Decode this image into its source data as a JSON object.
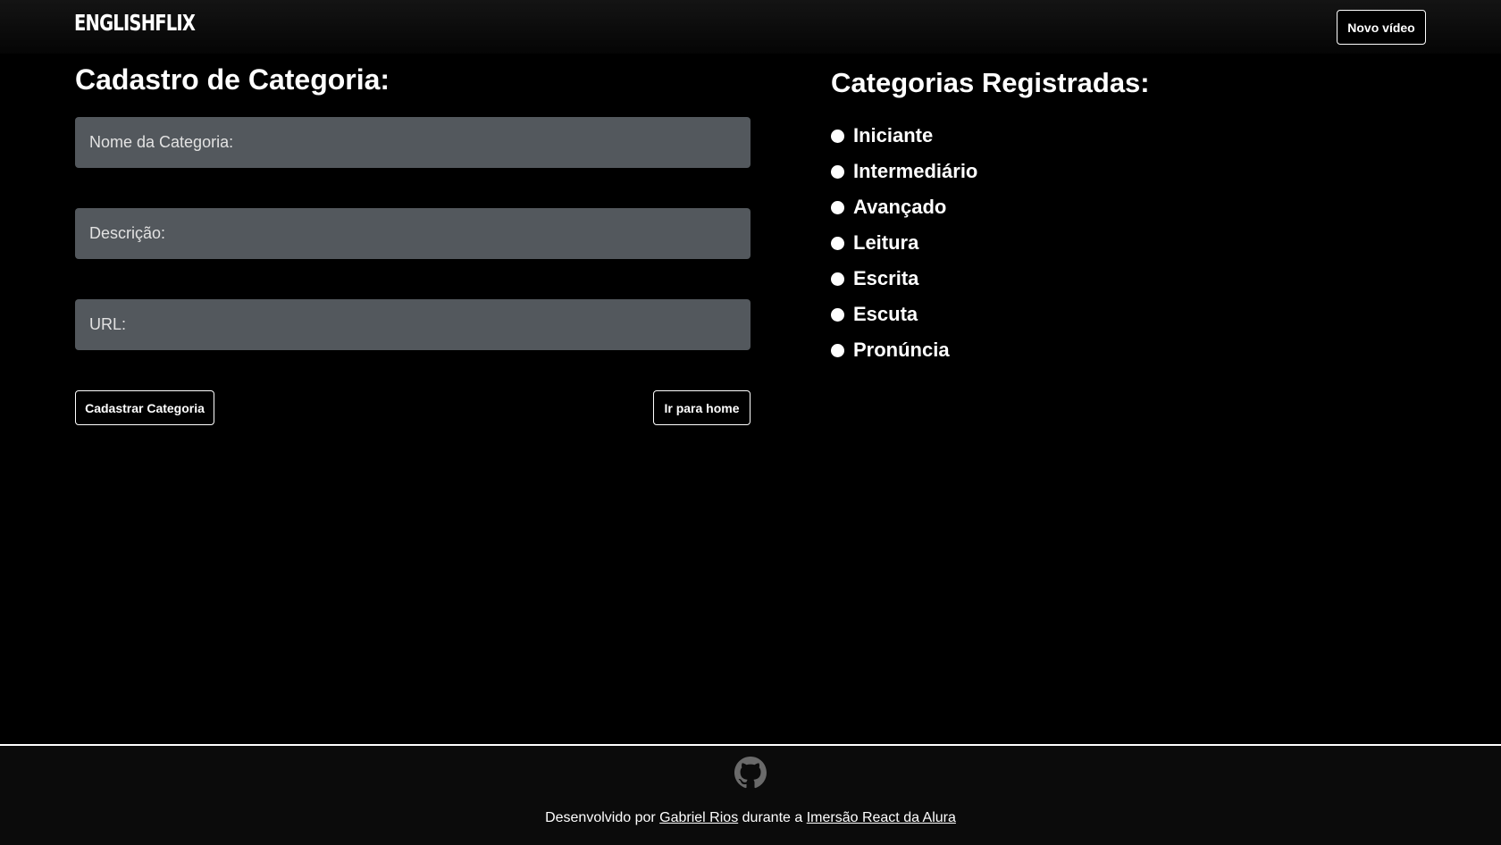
{
  "header": {
    "logo_text": "ENGLISHFLIX",
    "new_video_label": "Novo vídeo"
  },
  "form": {
    "title": "Cadastro de Categoria:",
    "name_placeholder": "Nome da Categoria:",
    "description_placeholder": "Descrição:",
    "url_placeholder": "URL:",
    "submit_label": "Cadastrar Categoria",
    "home_label": "Ir para home"
  },
  "categories": {
    "title": "Categorias Registradas:",
    "items": [
      "Iniciante",
      "Intermediário",
      "Avançado",
      "Leitura",
      "Escrita",
      "Escuta",
      "Pronúncia"
    ]
  },
  "footer": {
    "icon": "github-icon",
    "prefix": "Desenvolvido por",
    "author_link": "Gabriel Rios",
    "middle": "durante a",
    "event_link": "Imersão React da Alura"
  },
  "colors": {
    "background": "#000000",
    "input_background": "#53585d",
    "text": "#ffffff",
    "footer_background": "#0b0b0b"
  }
}
